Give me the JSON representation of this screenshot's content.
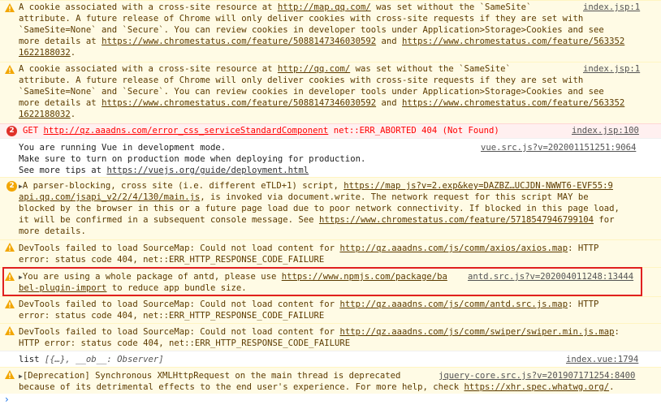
{
  "entries": [
    {
      "lines": [
        "A cookie associated with a cross-site resource at ",
        "http://map.qq.com/",
        " was set without the `SameSite`",
        "attribute. A future release of Chrome will only deliver cookies with cross-site requests if they are set with",
        "`SameSite=None` and `Secure`. You can review cookies in developer tools under Application>Storage>Cookies and see",
        "more details at ",
        "https://www.chromestatus.com/feature/5088147346030592",
        " and ",
        "https://www.chromestatus.com/feature/563352",
        "1622188032",
        "."
      ],
      "source": "index.jsp:1"
    },
    {
      "lines": [
        "A cookie associated with a cross-site resource at ",
        "http://qq.com/",
        " was set without the `SameSite`",
        "attribute. A future release of Chrome will only deliver cookies with cross-site requests if they are set with",
        "`SameSite=None` and `Secure`. You can review cookies in developer tools under Application>Storage>Cookies and see",
        "more details at ",
        "https://www.chromestatus.com/feature/5088147346030592",
        " and ",
        "https://www.chromestatus.com/feature/563352",
        "1622188032",
        "."
      ],
      "source": "index.jsp:1"
    },
    {
      "badge": "2",
      "method": "GET ",
      "url": "http://qz.aaadns.com/error_css_serviceStandardComponent",
      "status": " net::ERR_ABORTED 404 (Not Found)",
      "source": "index.jsp:100"
    },
    {
      "lines": [
        "You are running Vue in development mode.",
        "Make sure to turn on production mode when deploying for production.",
        "See more tips at ",
        "https://vuejs.org/guide/deployment.html"
      ],
      "source": "vue.src.js?v=202001151251:9064"
    },
    {
      "badge": "2",
      "lines": [
        "A parser-blocking, cross site (i.e. different eTLD+1) script, ",
        "https://map js?v=2.exp&key=DAZBZ…UCJDN-NWWT6-EVF55:9",
        "api.qq.com/jsapi_v2/2/4/130/main.js",
        ", is invoked via document.write. The network request for this script MAY be",
        "blocked by the browser in this or a future page load due to poor network connectivity. If blocked in this page load,",
        "it will be confirmed in a subsequent console message. See ",
        "https://www.chromestatus.com/feature/5718547946799104",
        " for",
        "more details."
      ]
    },
    {
      "lines": [
        "DevTools failed to load SourceMap: Could not load content for ",
        "http://qz.aaadns.com/js/comm/axios/axios.map",
        ": HTTP",
        "error: status code 404, net::ERR_HTTP_RESPONSE_CODE_FAILURE"
      ]
    },
    {
      "lines": [
        "You are using a whole package of antd, please use ",
        "https://www.npmjs.com/package/ba",
        "bel-plugin-import",
        " to reduce app bundle size."
      ],
      "source": "antd.src.js?v=202004011248:13444"
    },
    {
      "lines": [
        "DevTools failed to load SourceMap: Could not load content for ",
        "http://qz.aaadns.com/js/comm/antd.src.js.map",
        ": HTTP",
        "error: status code 404, net::ERR_HTTP_RESPONSE_CODE_FAILURE"
      ]
    },
    {
      "lines": [
        "DevTools failed to load SourceMap: Could not load content for ",
        "http://qz.aaadns.com/js/comm/swiper/swiper.min.js.map",
        ":",
        "HTTP error: status code 404, net::ERR_HTTP_RESPONSE_CODE_FAILURE"
      ]
    },
    {
      "text": "list ",
      "obj": "[{…}, __ob__: Observer]",
      "source": "index.vue:1794"
    },
    {
      "lines": [
        "[Deprecation] Synchronous XMLHttpRequest on the main thread is deprecated",
        "because of its detrimental effects to the end user's experience. For more help, check ",
        "https://xhr.spec.whatwg.org/",
        "."
      ],
      "source": "jquery-core.src.js?v=201907171254:8400"
    }
  ],
  "prompt": "›",
  "colors": {
    "warn_bg": "#fffbe5",
    "error_bg": "#fff0f0",
    "highlight": "#e02020"
  }
}
